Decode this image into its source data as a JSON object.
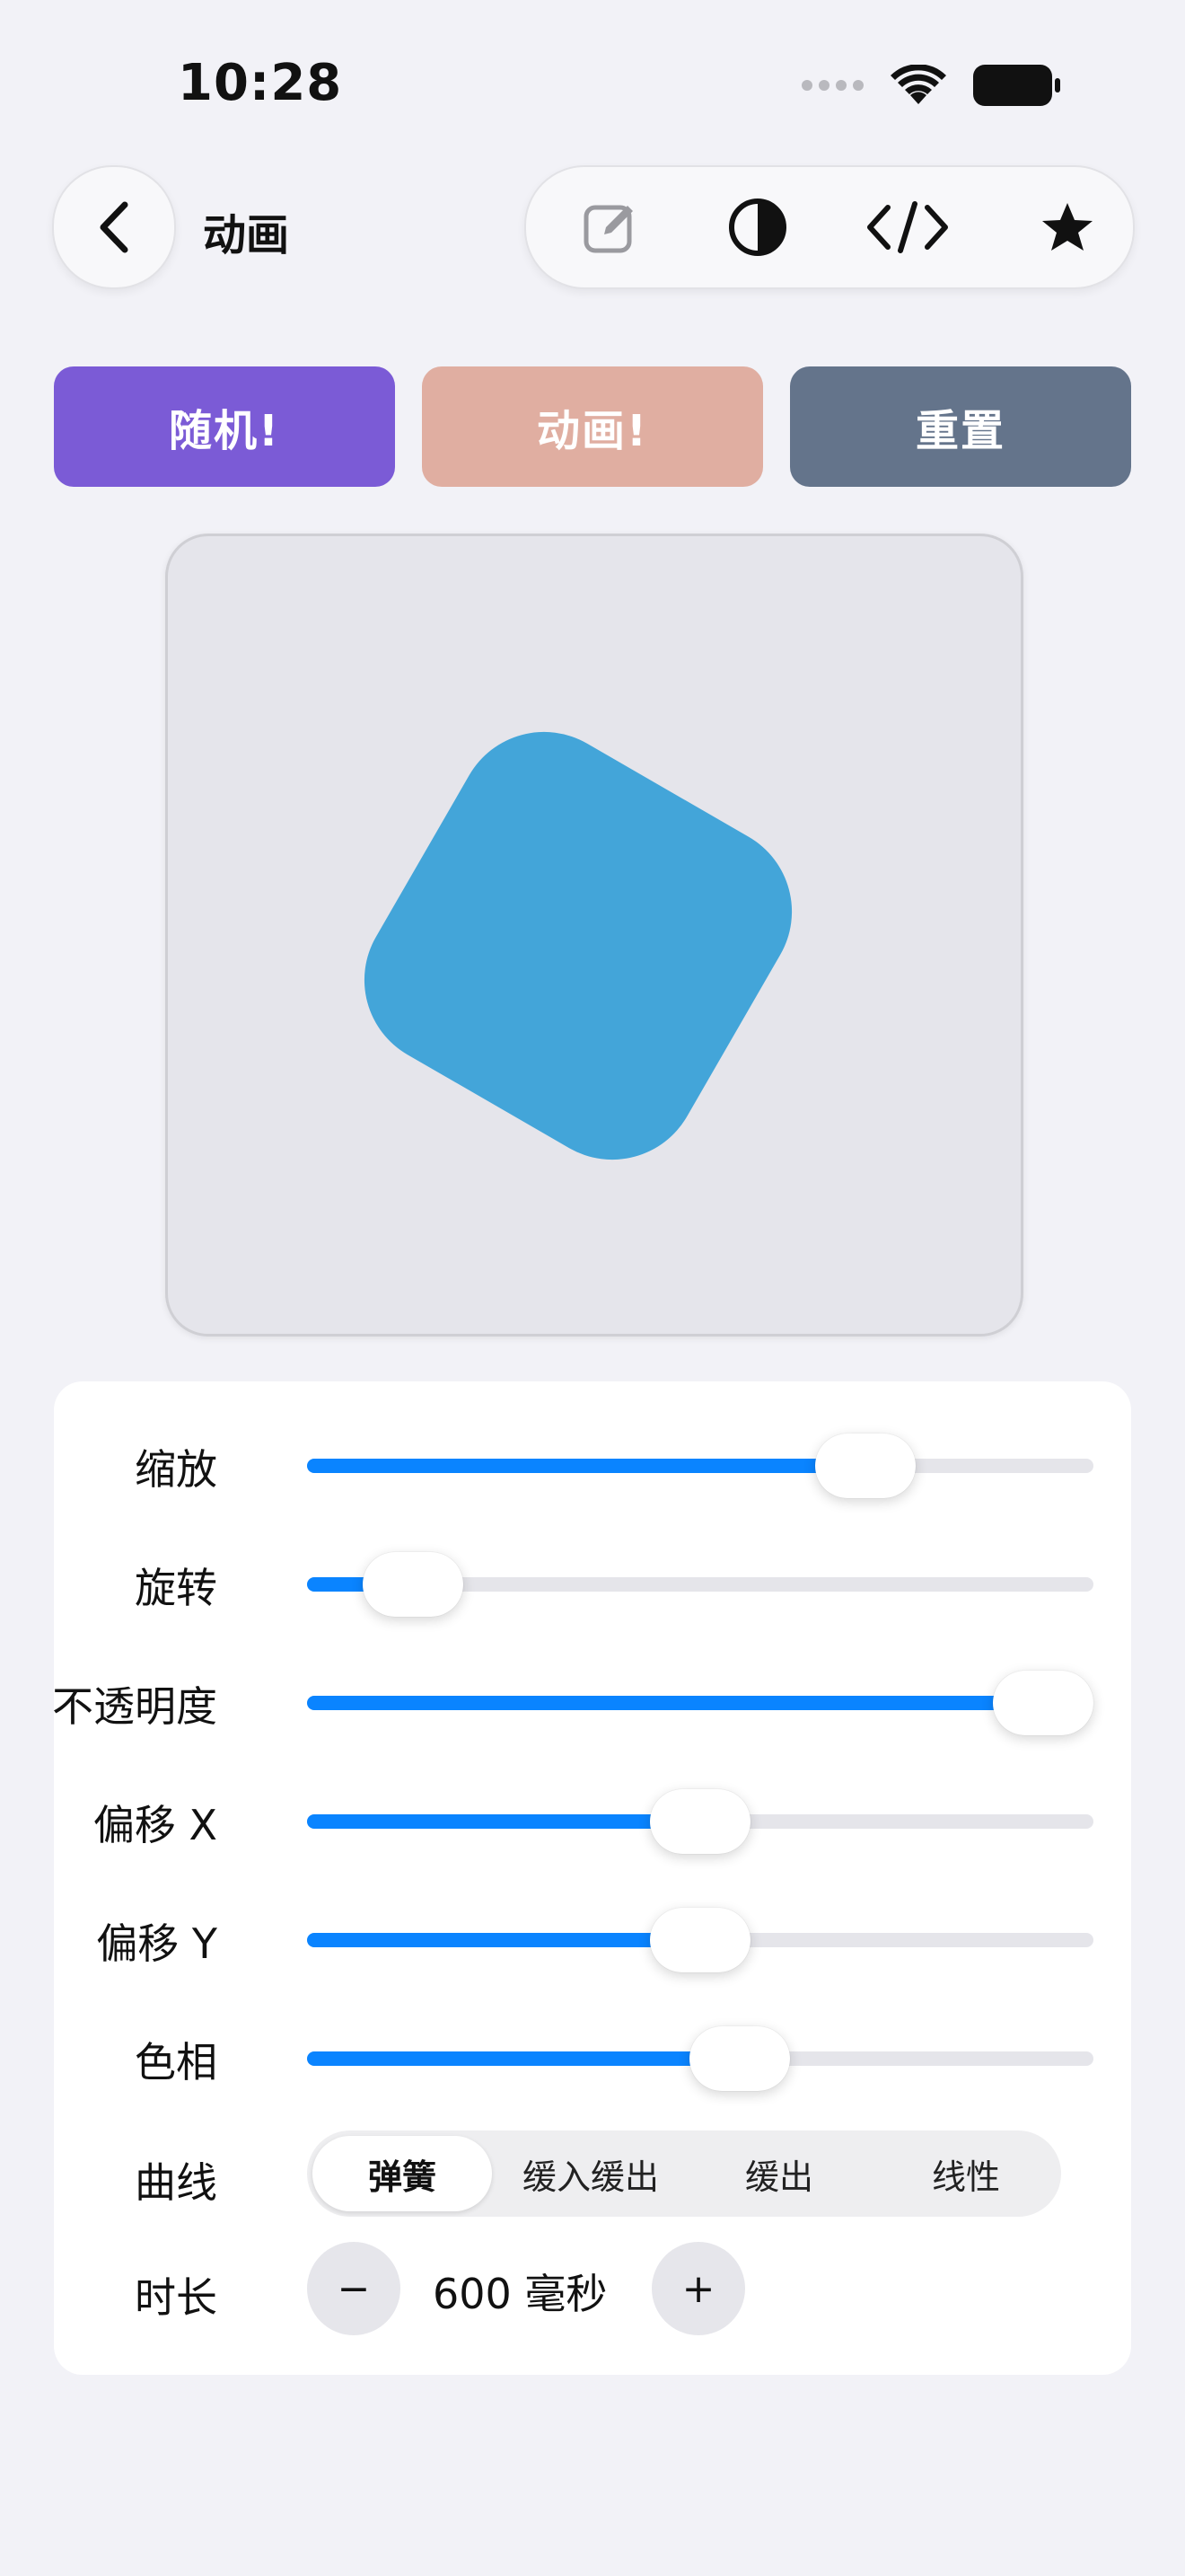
{
  "status_bar": {
    "time": "10:28",
    "icons": [
      "signal-dots-icon",
      "wifi-icon",
      "battery-icon"
    ]
  },
  "nav": {
    "title": "动画",
    "back_icon": "chevron-left-icon",
    "tools": [
      "edit-icon",
      "contrast-icon",
      "code-icon",
      "star-icon"
    ]
  },
  "actions": {
    "random_label": "随机!",
    "animate_label": "动画!",
    "reset_label": "重置",
    "colors": {
      "random": "#7b5bd6",
      "animate": "#e0aea1",
      "reset": "#64748b"
    }
  },
  "preview": {
    "shape_color": "#43a5d9",
    "shape_rotation_deg": 30
  },
  "controls": {
    "accent_color": "#0a84ff",
    "sliders": [
      {
        "label": "缩放",
        "value": 0.71
      },
      {
        "label": "旋转",
        "value": 0.135
      },
      {
        "label": "不透明度",
        "value": 0.98
      },
      {
        "label": "偏移 X",
        "value": 0.5
      },
      {
        "label": "偏移 Y",
        "value": 0.5
      },
      {
        "label": "色相",
        "value": 0.55
      }
    ],
    "curve": {
      "label": "曲线",
      "options": [
        "弹簧",
        "缓入缓出",
        "缓出",
        "线性"
      ],
      "selected": "弹簧"
    },
    "duration": {
      "label": "时长",
      "value": "600 毫秒",
      "minus": "−",
      "plus": "+"
    }
  }
}
